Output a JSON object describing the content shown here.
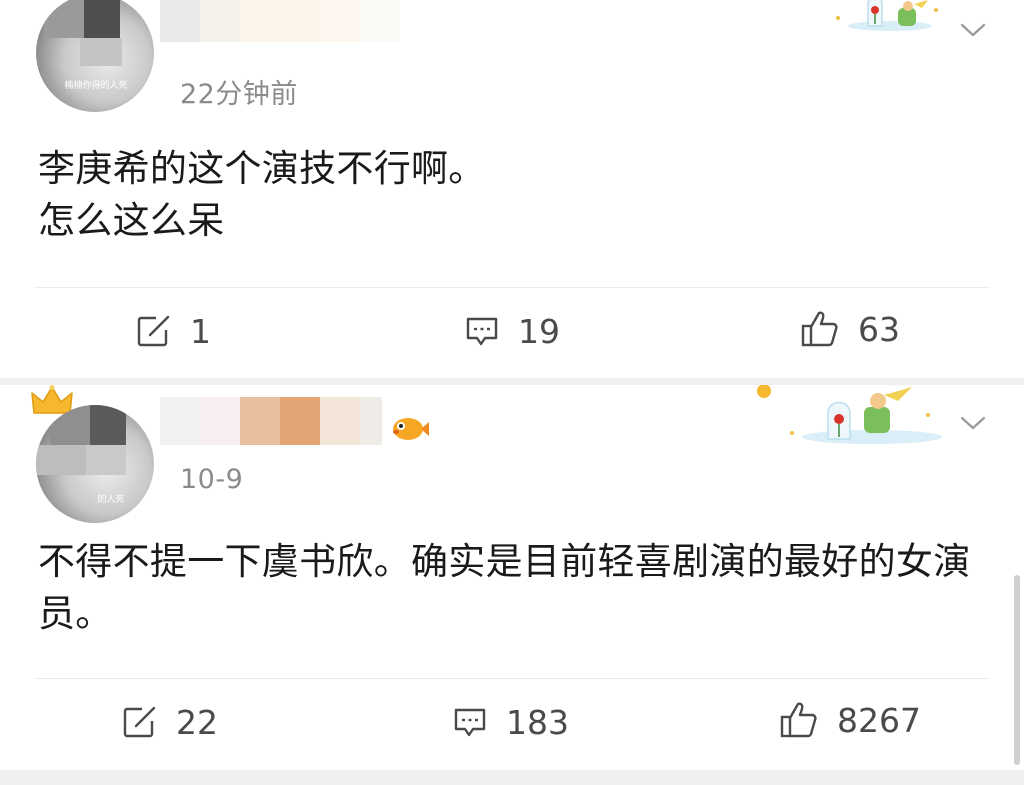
{
  "posts": [
    {
      "timestamp": "22分钟前",
      "avatar_caption": "楠楠你得的人死",
      "content": "李庚希的这个演技不行啊。\n怎么这么呆",
      "actions": {
        "repost": "1",
        "comment": "19",
        "like": "63"
      }
    },
    {
      "timestamp": "10-9",
      "avatar_caption": "的人死",
      "content": "不得不提一下虞书欣。确实是目前轻喜剧演的最好的女演员。",
      "actions": {
        "repost": "22",
        "comment": "183",
        "like": "8267"
      }
    }
  ],
  "icons": {
    "repost": "edit-square-icon",
    "comment": "comment-bubble-icon",
    "like": "thumbs-up-icon",
    "more": "chevron-down-icon",
    "badge": "crown-icon"
  },
  "colors": {
    "text": "#1a1a1a",
    "muted": "#8b8b8b",
    "action": "#4a4a4a",
    "separator": "#efefef"
  }
}
